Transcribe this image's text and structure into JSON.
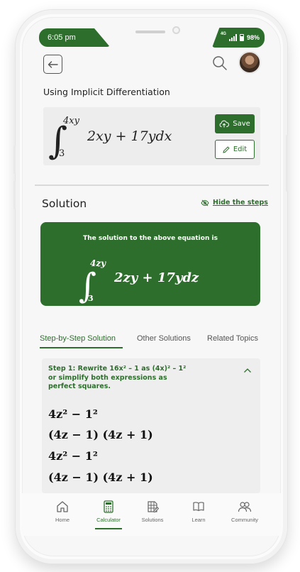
{
  "status": {
    "time": "6:05 pm",
    "network": "4G",
    "battery": "98%"
  },
  "header": {
    "back_icon": "arrow-left-icon",
    "search_icon": "search-icon",
    "avatar": "user-avatar"
  },
  "method_title": "Using Implicit Differentiation",
  "equation": {
    "upper_limit": "4xy",
    "lower_limit": "3",
    "integrand": "2xy + 17ydx",
    "save_label": "Save",
    "edit_label": "Edit"
  },
  "solution": {
    "heading": "Solution",
    "hide_steps_label": "Hide the steps",
    "result_caption": "The solution to the above equation is",
    "result_upper": "4zy",
    "result_lower": "3",
    "result_integrand": "2zy + 17ydz"
  },
  "tabs": [
    {
      "label": "Step-by-Step  Solution",
      "active": true
    },
    {
      "label": "Other Solutions",
      "active": false
    },
    {
      "label": "Related Topics",
      "active": false
    }
  ],
  "step": {
    "text": "Step 1: Rewrite  16x² – 1  as  (4x)² – 1² or simplify both expressions as perfect squares.",
    "lines": [
      "4z² − 1²",
      "(4z − 1) (4z + 1)",
      "4z² − 1²",
      "(4z − 1) (4z + 1)"
    ]
  },
  "bottom_nav": [
    {
      "label": "Home",
      "icon": "home-icon",
      "active": false
    },
    {
      "label": "Calculator",
      "icon": "calculator-icon",
      "active": true
    },
    {
      "label": "Solutions",
      "icon": "solutions-icon",
      "active": false
    },
    {
      "label": "Learn",
      "icon": "book-icon",
      "active": false
    },
    {
      "label": "Community",
      "icon": "community-icon",
      "active": false
    }
  ],
  "colors": {
    "brand": "#2d6e2d",
    "card": "#ededed",
    "background": "#f7f7f7"
  }
}
